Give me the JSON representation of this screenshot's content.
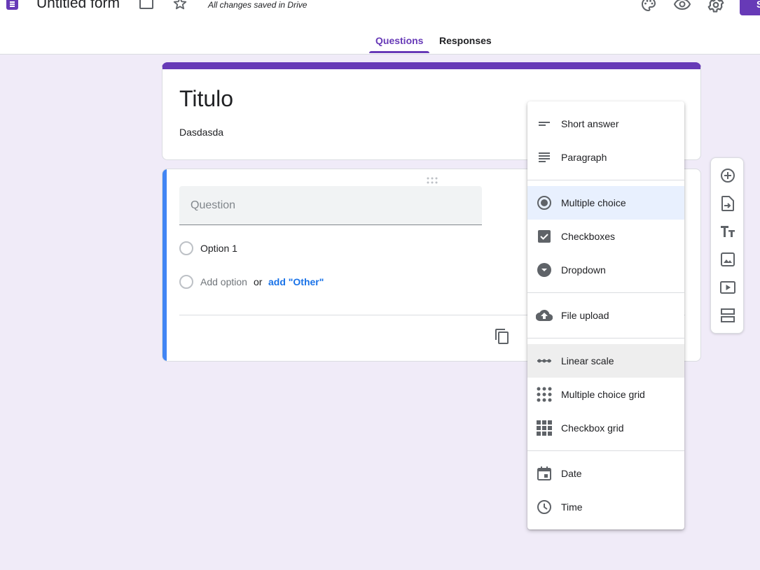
{
  "header": {
    "form_title": "Untitled form",
    "save_status": "All changes saved in Drive",
    "send_label": "S",
    "icons": [
      "forms-logo-icon",
      "folder-icon",
      "star-icon",
      "palette-icon",
      "eye-icon",
      "gear-icon"
    ]
  },
  "tabs": [
    {
      "label": "Questions",
      "active": true
    },
    {
      "label": "Responses",
      "active": false
    }
  ],
  "title_card": {
    "title": "Titulo",
    "description": "Dasdasda"
  },
  "question_card": {
    "question_placeholder": "Question",
    "option_1": "Option 1",
    "add_option": "Add option",
    "or": "or",
    "add_other": "add \"Other\""
  },
  "type_menu": {
    "items": [
      {
        "label": "Short answer",
        "icon": "short-answer-icon"
      },
      {
        "label": "Paragraph",
        "icon": "paragraph-icon"
      },
      {
        "label": "Multiple choice",
        "icon": "radio-icon",
        "selected": true
      },
      {
        "label": "Checkboxes",
        "icon": "checkbox-icon"
      },
      {
        "label": "Dropdown",
        "icon": "dropdown-icon"
      },
      {
        "label": "File upload",
        "icon": "cloud-upload-icon"
      },
      {
        "label": "Linear scale",
        "icon": "linear-scale-icon",
        "hovered": true
      },
      {
        "label": "Multiple choice grid",
        "icon": "dot-grid-icon"
      },
      {
        "label": "Checkbox grid",
        "icon": "square-grid-icon"
      },
      {
        "label": "Date",
        "icon": "calendar-icon"
      },
      {
        "label": "Time",
        "icon": "clock-icon"
      }
    ]
  },
  "toolbar": {
    "buttons": [
      "add-question-icon",
      "import-questions-icon",
      "add-title-icon",
      "add-image-icon",
      "add-video-icon",
      "add-section-icon"
    ]
  },
  "colors": {
    "accent": "#673ab7",
    "background": "#f0ebf8",
    "active_bar": "#4285f4",
    "link": "#1a73e8",
    "selected_item": "#e8f0fe"
  }
}
